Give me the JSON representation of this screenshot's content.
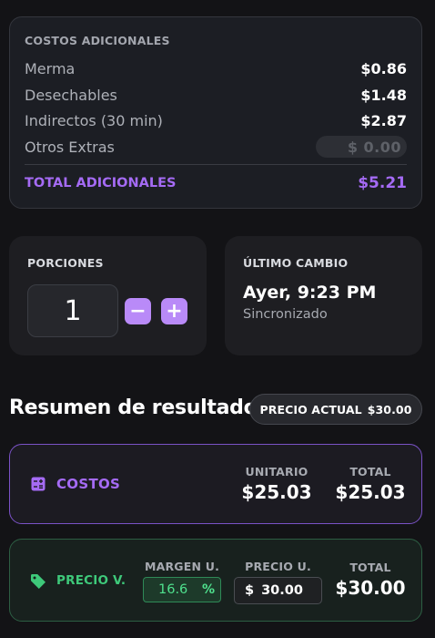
{
  "extras": {
    "heading": "COSTOS ADICIONALES",
    "rows": [
      {
        "label": "Merma",
        "value": "$0.86"
      },
      {
        "label": "Desechables",
        "value": "$1.48"
      },
      {
        "label": "Indirectos (30 min)",
        "value": "$2.87"
      }
    ],
    "otros": {
      "label": "Otros Extras",
      "placeholder": "$ 0.00"
    },
    "total": {
      "label": "TOTAL ADICIONALES",
      "value": "$5.21"
    }
  },
  "porciones": {
    "heading": "PORCIONES",
    "value": "1",
    "minus": "−",
    "plus": "+"
  },
  "cambio": {
    "heading": "ÚLTIMO CAMBIO",
    "when": "Ayer, 9:23 PM",
    "status": "Sincronizado"
  },
  "resumen": {
    "title": "Resumen de resultados",
    "pill_label": "PRECIO ACTUAL",
    "pill_value": "$30.00"
  },
  "costos": {
    "name": "COSTOS",
    "unit_header": "UNITARIO",
    "unit_value": "$25.03",
    "total_header": "TOTAL",
    "total_value": "$25.03"
  },
  "precio": {
    "name": "PRECIO V.",
    "margin_header": "MARGEN U.",
    "margin_value": "16.6",
    "margin_unit": "%",
    "price_header": "PRECIO U.",
    "price_currency": "$",
    "price_value": "30.00",
    "total_header": "TOTAL",
    "total_value": "$30.00"
  },
  "colors": {
    "accent_purple": "#a56bf5",
    "accent_green": "#3ec97a",
    "background": "#131316"
  }
}
